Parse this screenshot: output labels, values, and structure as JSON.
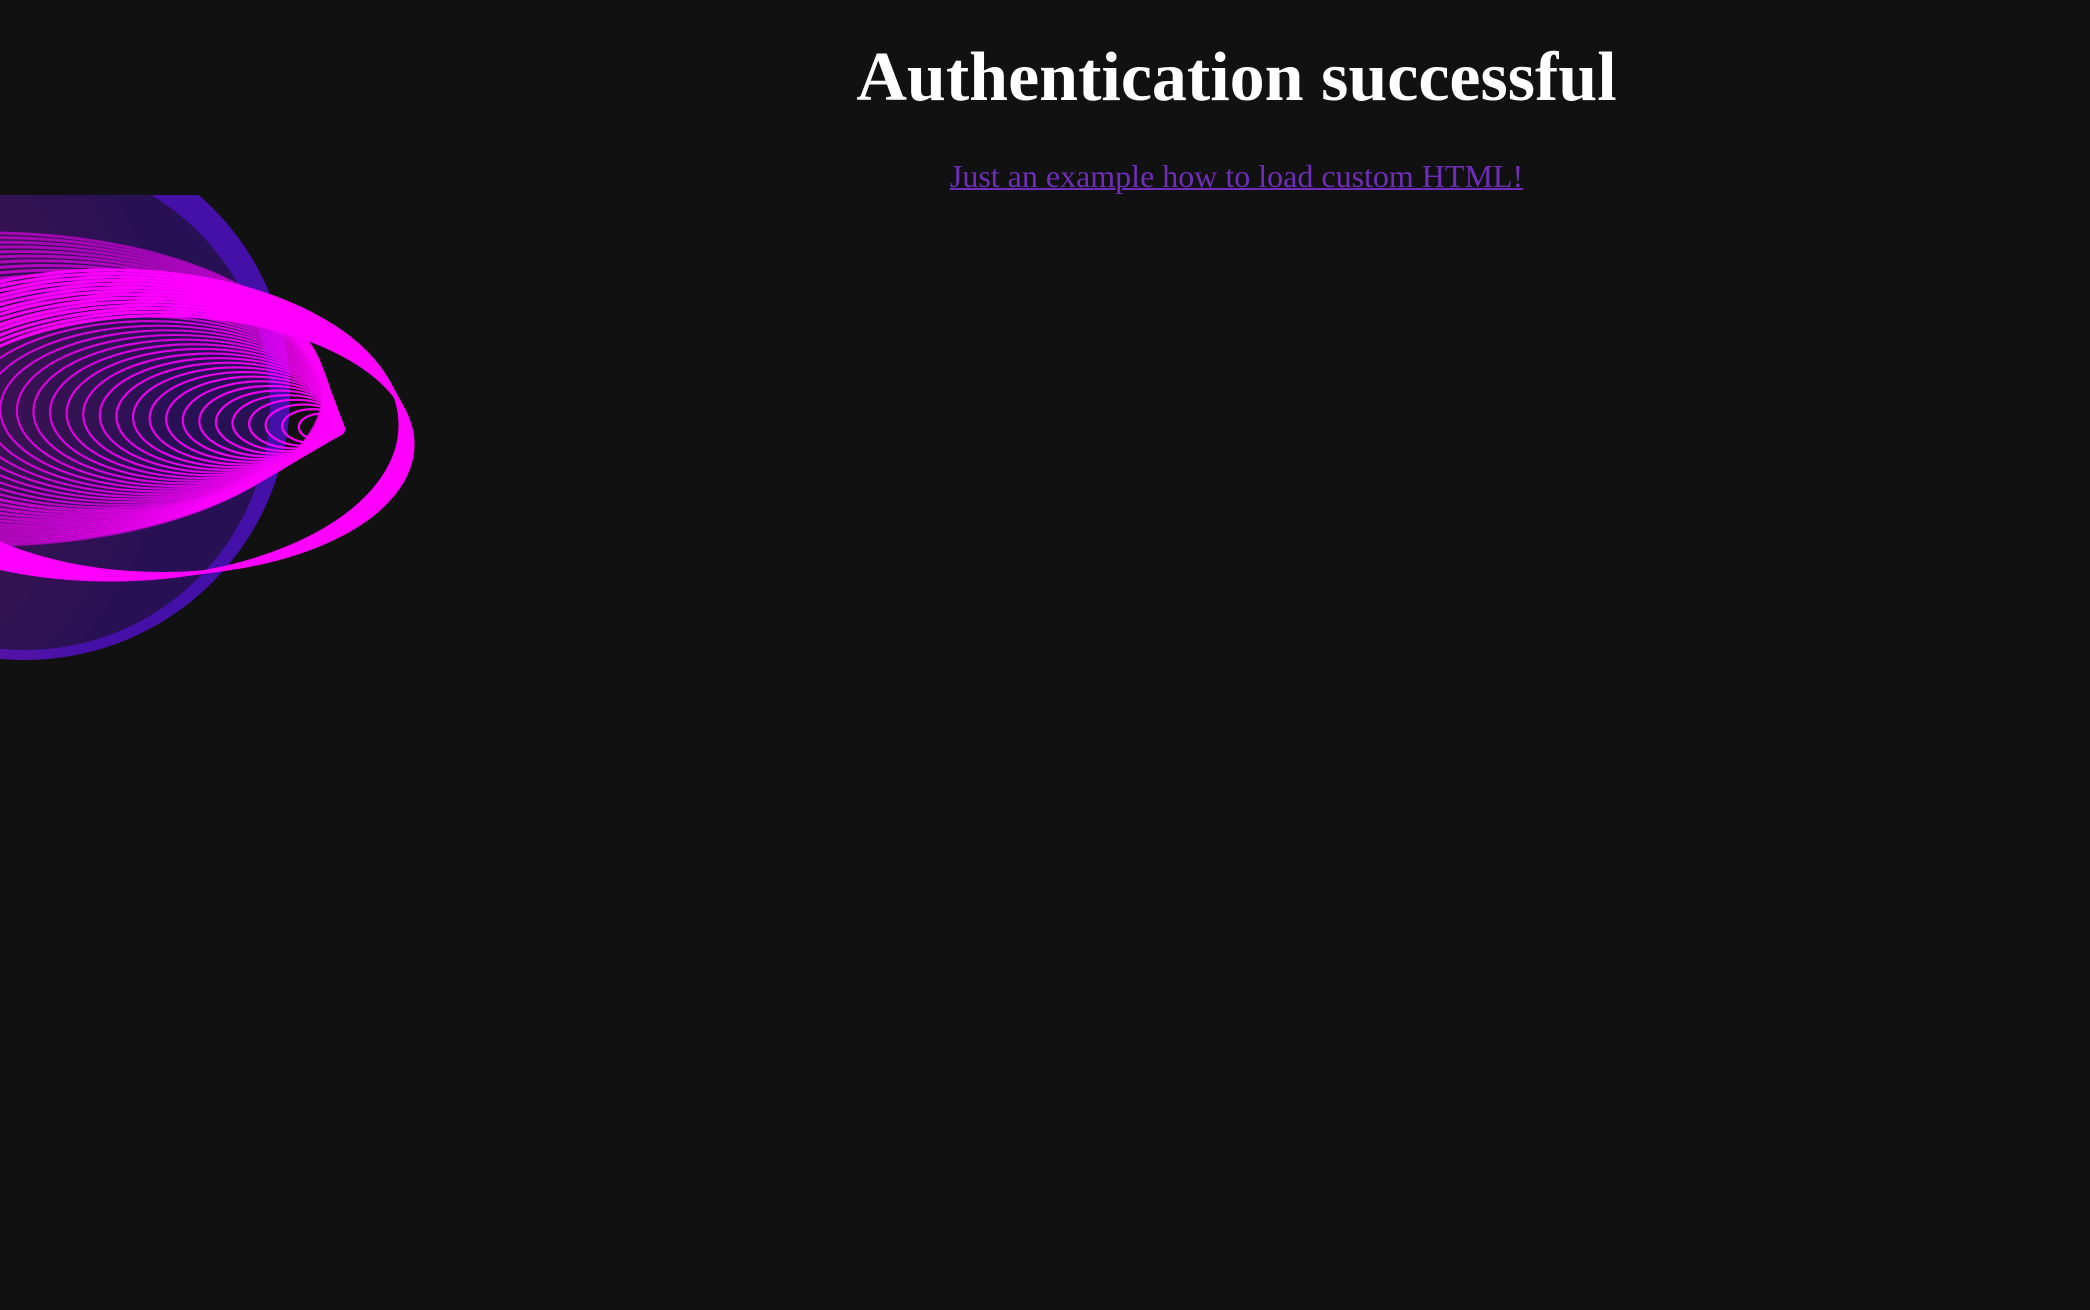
{
  "page": {
    "title": "Authentication successful",
    "link_text": "Just an example how to load custom HTML!"
  },
  "colors": {
    "background": "#111111",
    "title": "#ffffff",
    "link": "#6f2db8",
    "art_magenta": "#ff00ff",
    "art_purple": "#5a17c9"
  },
  "decoration": {
    "icon": "concentric-rings-animation"
  }
}
